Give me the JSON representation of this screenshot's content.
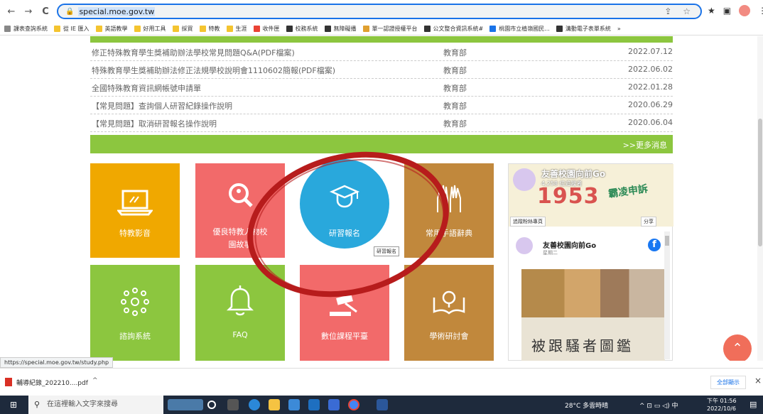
{
  "browser": {
    "url": "special.moe.gov.tw",
    "nav_back": "←",
    "nav_forward": "→",
    "nav_reload": "C",
    "lock": "🔒",
    "omnibox_icons": "⇪ ☆",
    "ext_icon": "★",
    "window_icon": "▣",
    "menu_icon": "⋮",
    "bookmarks": [
      {
        "label": "課表查詢系統",
        "color": "#888"
      },
      {
        "label": "從 IE 匯入",
        "color": "#f4c430"
      },
      {
        "label": "英語教學",
        "color": "#f4c430"
      },
      {
        "label": "好用工具",
        "color": "#f4c430"
      },
      {
        "label": "採買",
        "color": "#f4c430"
      },
      {
        "label": "特教",
        "color": "#f4c430"
      },
      {
        "label": "生涯",
        "color": "#f4c430"
      },
      {
        "label": "收件匣",
        "color": "#ea4335"
      },
      {
        "label": "校務系統",
        "color": "#333"
      },
      {
        "label": "無障礙播",
        "color": "#333"
      },
      {
        "label": "單一認證授權平台",
        "color": "#e0a030"
      },
      {
        "label": "公文整合資訊系統#",
        "color": "#333"
      },
      {
        "label": "桃園市立植嶺國民...",
        "color": "#1a73e8"
      },
      {
        "label": "溝動電子表單系統",
        "color": "#333"
      }
    ],
    "bookmarks_more": "»"
  },
  "news": [
    {
      "title": "修正特殊教育學生獎補助辦法學校常見問題Q&A(PDF檔案)",
      "unit": "教育部",
      "date": "2022.07.12"
    },
    {
      "title": "特殊教育學生獎補助辦法修正法規學校說明會1110602簡報(PDF檔案)",
      "unit": "教育部",
      "date": "2022.06.02"
    },
    {
      "title": "全國特殊教育資訊網帳號申請單",
      "unit": "教育部",
      "date": "2022.01.28"
    },
    {
      "title": "【常見問題】查詢個人研習紀錄操作說明",
      "unit": "教育部",
      "date": "2020.06.29"
    },
    {
      "title": "【常見問題】取消研習報名操作說明",
      "unit": "教育部",
      "date": "2020.06.04"
    }
  ],
  "more_news": ">>更多消息",
  "tiles": {
    "video": "特教影音",
    "story": "優良特教人物校園故事",
    "register": "研習報名",
    "handbook": "常用手語辭典",
    "consult": "諮詢系統",
    "faq": "FAQ",
    "digital": "數位課程平臺",
    "academic": "學術研討會"
  },
  "tooltip": "研習報名",
  "facebook": {
    "page_name": "友善校園向前Go",
    "followers": "4,258 位追蹤者",
    "year": "1953",
    "slogan": "霸凌申訴",
    "follow_btn": "追蹤粉絲專頁",
    "share_btn": "分享",
    "post_name": "友善校園向前Go",
    "post_day": "星期二",
    "fb_logo": "f",
    "image_title": "被跟騷者圖鑑"
  },
  "scroll_top": "⌃",
  "status_url": "https://special.moe.gov.tw/study.php",
  "downloads": {
    "filename": "輔導紀錄_202210....pdf",
    "caret": "^",
    "show_all": "全部顯示",
    "close": "×"
  },
  "taskbar": {
    "start": "⊞",
    "search_placeholder": "在這裡輸入文字來搜尋",
    "search_icon": "⚲",
    "weather": "28°C 多雲時晴",
    "tray": "^ ⊡ ▭ ◁) 中",
    "time": "下午 01:56",
    "date": "2022/10/6",
    "notification": "▤"
  },
  "colors": {
    "green": "#8cc63f",
    "orange": "#f0a800",
    "coral": "#f26a6a",
    "blue": "#29a8dc",
    "brown": "#c1883c",
    "annotation": "#b71c1c"
  }
}
